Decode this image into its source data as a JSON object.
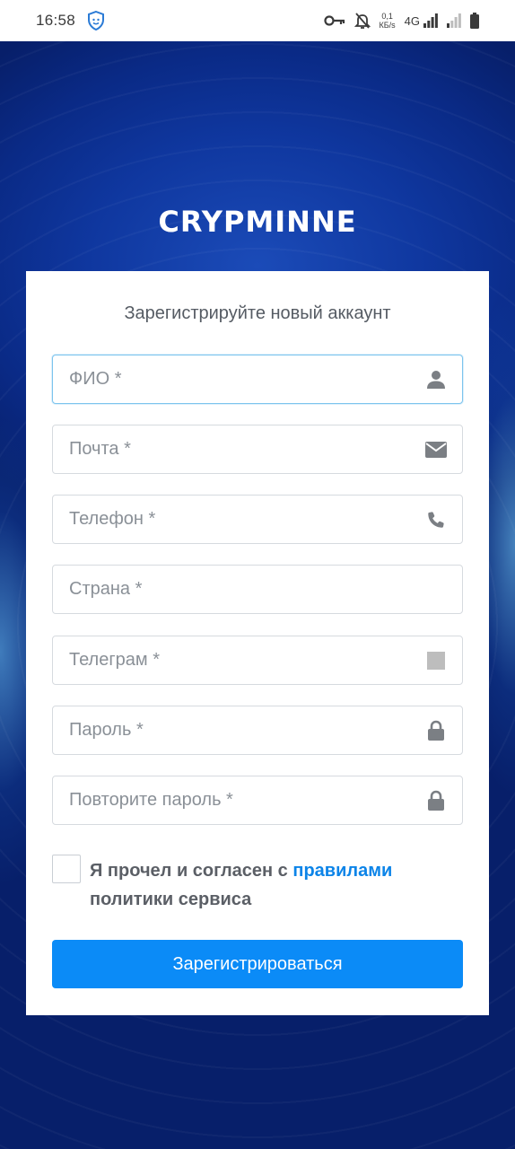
{
  "status_bar": {
    "time": "16:58",
    "speed_value": "0,1",
    "speed_unit": "КБ/s",
    "network": "4G",
    "icons": [
      "shield-face-icon",
      "key-icon",
      "bell-off-icon",
      "signal-icon",
      "signal-weak-icon",
      "battery-icon"
    ]
  },
  "logo": {
    "text": "CRYPMINNE"
  },
  "form": {
    "title": "Зарегистрируйте новый аккаунт",
    "fields": [
      {
        "placeholder": "ФИО *",
        "icon": "user-icon"
      },
      {
        "placeholder": "Почта *",
        "icon": "envelope-icon"
      },
      {
        "placeholder": "Телефон *",
        "icon": "phone-icon"
      },
      {
        "placeholder": "Страна *",
        "icon": ""
      },
      {
        "placeholder": "Телеграм *",
        "icon": "telegram-placeholder-icon"
      },
      {
        "placeholder": "Пароль *",
        "icon": "lock-icon"
      },
      {
        "placeholder": "Повторите пароль *",
        "icon": "lock-icon"
      }
    ],
    "agree": {
      "prefix": "Я прочел и согласен с ",
      "link": "правилами",
      "suffix": " политики сервиса"
    },
    "submit_label": "Зарегистрироваться"
  },
  "colors": {
    "background": "#0b2a8c",
    "accent": "#0b8bf7",
    "link": "#0c84e8",
    "focus_border": "#7cc4ee"
  }
}
